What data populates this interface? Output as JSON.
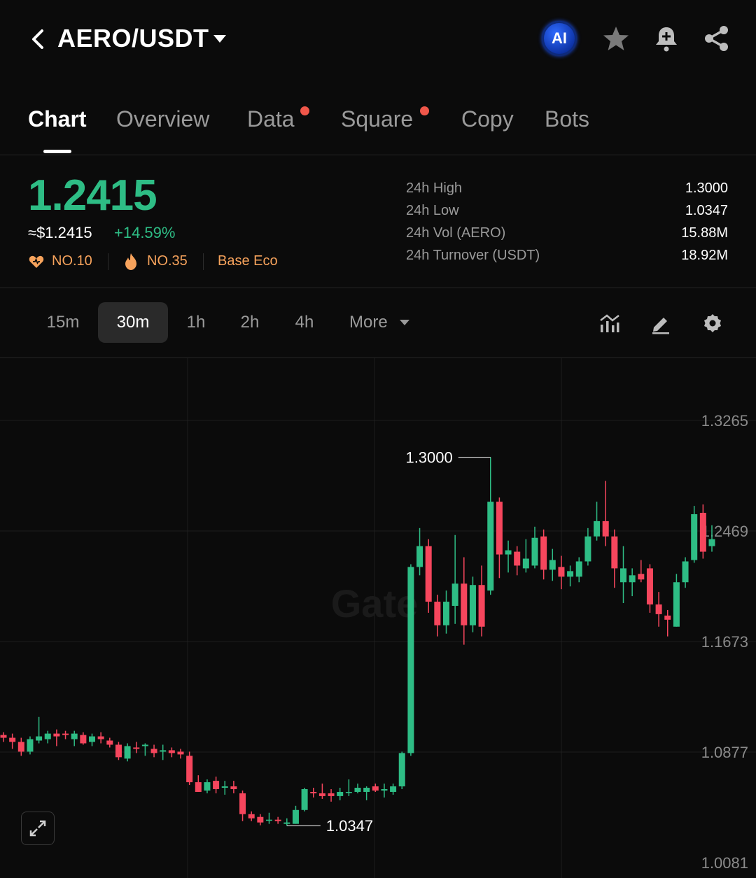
{
  "header": {
    "pair": "AERO/USDT",
    "ai_label": "AI"
  },
  "tabs": [
    {
      "label": "Chart",
      "active": true,
      "dot": false
    },
    {
      "label": "Overview",
      "active": false,
      "dot": false
    },
    {
      "label": "Data",
      "active": false,
      "dot": true
    },
    {
      "label": "Square",
      "active": false,
      "dot": true
    },
    {
      "label": "Copy",
      "active": false,
      "dot": false
    },
    {
      "label": "Bots",
      "active": false,
      "dot": false
    }
  ],
  "ticker": {
    "last_price": "1.2415",
    "usd_price": "≈$1.2415",
    "change": "+14.59%",
    "badges": [
      "NO.10",
      "NO.35",
      "Base Eco"
    ],
    "stats": [
      {
        "label": "24h High",
        "value": "1.3000"
      },
      {
        "label": "24h Low",
        "value": "1.0347"
      },
      {
        "label": "24h Vol (AERO)",
        "value": "15.88M"
      },
      {
        "label": "24h Turnover (USDT)",
        "value": "18.92M"
      }
    ]
  },
  "intervals": [
    "15m",
    "30m",
    "1h",
    "2h",
    "4h",
    "More"
  ],
  "active_interval": "30m",
  "colors": {
    "up": "#2ebd85",
    "down": "#f6465d",
    "background": "#0b0b0b"
  },
  "chart_data": {
    "type": "candlestick",
    "y_ticks": [
      "1.3265",
      "1.2469",
      "1.1673",
      "1.0877",
      "1.0081"
    ],
    "ylim": [
      1.0081,
      1.3265
    ],
    "high_label": "1.3000",
    "low_label": "1.0347",
    "watermark": "Gate",
    "candles": [
      [
        1.1,
        1.102,
        1.095,
        1.098
      ],
      [
        1.098,
        1.101,
        1.09,
        1.095
      ],
      [
        1.095,
        1.098,
        1.085,
        1.088
      ],
      [
        1.088,
        1.099,
        1.086,
        1.097
      ],
      [
        1.096,
        1.113,
        1.094,
        1.099
      ],
      [
        1.097,
        1.103,
        1.094,
        1.101
      ],
      [
        1.101,
        1.104,
        1.092,
        1.099
      ],
      [
        1.101,
        1.103,
        1.097,
        1.1
      ],
      [
        1.097,
        1.103,
        1.092,
        1.101
      ],
      [
        1.1,
        1.102,
        1.093,
        1.094
      ],
      [
        1.095,
        1.101,
        1.092,
        1.099
      ],
      [
        1.099,
        1.102,
        1.094,
        1.097
      ],
      [
        1.096,
        1.098,
        1.091,
        1.093
      ],
      [
        1.093,
        1.095,
        1.082,
        1.084
      ],
      [
        1.083,
        1.094,
        1.081,
        1.092
      ],
      [
        1.091,
        1.095,
        1.087,
        1.09
      ],
      [
        1.092,
        1.094,
        1.085,
        1.093
      ],
      [
        1.09,
        1.093,
        1.084,
        1.087
      ],
      [
        1.088,
        1.093,
        1.082,
        1.089
      ],
      [
        1.089,
        1.091,
        1.084,
        1.087
      ],
      [
        1.088,
        1.09,
        1.083,
        1.086
      ],
      [
        1.085,
        1.088,
        1.064,
        1.066
      ],
      [
        1.066,
        1.071,
        1.059,
        1.059
      ],
      [
        1.06,
        1.068,
        1.058,
        1.066
      ],
      [
        1.067,
        1.07,
        1.058,
        1.061
      ],
      [
        1.062,
        1.067,
        1.057,
        1.063
      ],
      [
        1.063,
        1.067,
        1.058,
        1.061
      ],
      [
        1.058,
        1.06,
        1.038,
        1.043
      ],
      [
        1.043,
        1.045,
        1.038,
        1.04
      ],
      [
        1.041,
        1.043,
        1.035,
        1.037
      ],
      [
        1.039,
        1.044,
        1.036,
        1.039
      ],
      [
        1.039,
        1.041,
        1.036,
        1.038
      ],
      [
        1.036,
        1.04,
        1.0347,
        1.037
      ],
      [
        1.036,
        1.049,
        1.036,
        1.046
      ],
      [
        1.046,
        1.062,
        1.045,
        1.061
      ],
      [
        1.059,
        1.062,
        1.055,
        1.058
      ],
      [
        1.058,
        1.065,
        1.054,
        1.056
      ],
      [
        1.058,
        1.061,
        1.052,
        1.056
      ],
      [
        1.056,
        1.062,
        1.053,
        1.059
      ],
      [
        1.059,
        1.068,
        1.056,
        1.059
      ],
      [
        1.059,
        1.065,
        1.058,
        1.062
      ],
      [
        1.059,
        1.063,
        1.053,
        1.062
      ],
      [
        1.063,
        1.065,
        1.059,
        1.06
      ],
      [
        1.06,
        1.065,
        1.055,
        1.061
      ],
      [
        1.059,
        1.065,
        1.057,
        1.063
      ],
      [
        1.063,
        1.088,
        1.061,
        1.087
      ],
      [
        1.087,
        1.223,
        1.085,
        1.221
      ],
      [
        1.221,
        1.249,
        1.215,
        1.236
      ],
      [
        1.236,
        1.241,
        1.188,
        1.196
      ],
      [
        1.196,
        1.201,
        1.171,
        1.179
      ],
      [
        1.179,
        1.204,
        1.173,
        1.196
      ],
      [
        1.193,
        1.244,
        1.18,
        1.209
      ],
      [
        1.209,
        1.228,
        1.165,
        1.179
      ],
      [
        1.179,
        1.214,
        1.174,
        1.208
      ],
      [
        1.208,
        1.222,
        1.171,
        1.178
      ],
      [
        1.204,
        1.3,
        1.201,
        1.268
      ],
      [
        1.268,
        1.271,
        1.213,
        1.23
      ],
      [
        1.23,
        1.24,
        1.217,
        1.233
      ],
      [
        1.232,
        1.236,
        1.215,
        1.222
      ],
      [
        1.22,
        1.241,
        1.217,
        1.227
      ],
      [
        1.222,
        1.25,
        1.22,
        1.242
      ],
      [
        1.243,
        1.248,
        1.212,
        1.219
      ],
      [
        1.219,
        1.234,
        1.211,
        1.226
      ],
      [
        1.221,
        1.229,
        1.205,
        1.214
      ],
      [
        1.214,
        1.222,
        1.207,
        1.218
      ],
      [
        1.214,
        1.228,
        1.21,
        1.225
      ],
      [
        1.225,
        1.249,
        1.222,
        1.243
      ],
      [
        1.243,
        1.268,
        1.24,
        1.254
      ],
      [
        1.254,
        1.283,
        1.236,
        1.243
      ],
      [
        1.243,
        1.248,
        1.206,
        1.22
      ],
      [
        1.21,
        1.236,
        1.195,
        1.22
      ],
      [
        1.21,
        1.22,
        1.2,
        1.215
      ],
      [
        1.216,
        1.226,
        1.21,
        1.212
      ],
      [
        1.22,
        1.223,
        1.188,
        1.194
      ],
      [
        1.194,
        1.203,
        1.178,
        1.187
      ],
      [
        1.186,
        1.19,
        1.171,
        1.183
      ],
      [
        1.178,
        1.216,
        1.178,
        1.21
      ],
      [
        1.21,
        1.228,
        1.206,
        1.225
      ],
      [
        1.226,
        1.265,
        1.224,
        1.259
      ],
      [
        1.26,
        1.266,
        1.227,
        1.232
      ],
      [
        1.236,
        1.251,
        1.232,
        1.241
      ]
    ]
  }
}
